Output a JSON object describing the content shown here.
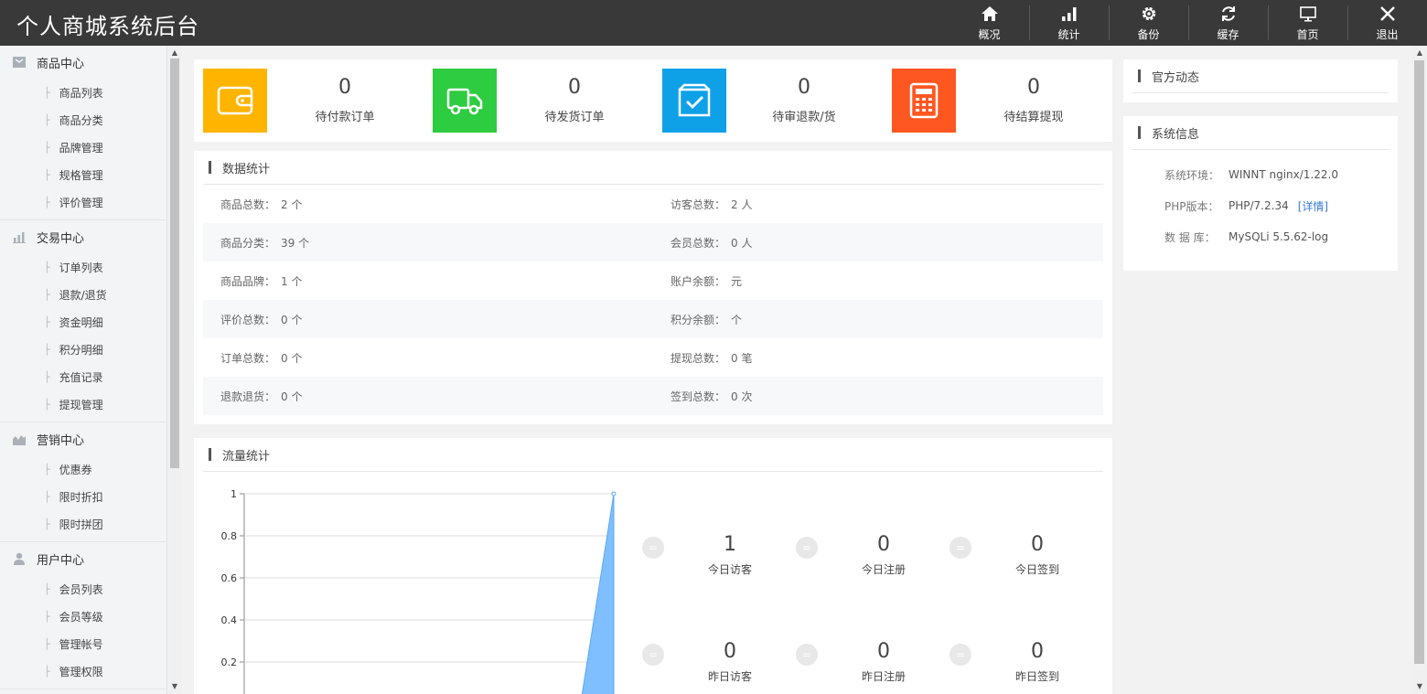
{
  "app": {
    "title": "个人商城系统后台"
  },
  "topnav": [
    {
      "label": "概况",
      "icon": "home-icon"
    },
    {
      "label": "统计",
      "icon": "bar-chart-icon"
    },
    {
      "label": "备份",
      "icon": "gear-icon"
    },
    {
      "label": "缓存",
      "icon": "refresh-icon"
    },
    {
      "label": "首页",
      "icon": "monitor-icon"
    },
    {
      "label": "退出",
      "icon": "close-icon"
    }
  ],
  "sidebar": {
    "groups": [
      {
        "title": "商品中心",
        "icon": "goods-icon",
        "items": [
          "商品列表",
          "商品分类",
          "品牌管理",
          "规格管理",
          "评价管理"
        ]
      },
      {
        "title": "交易中心",
        "icon": "bar-chart-icon",
        "items": [
          "订单列表",
          "退款/退货",
          "资金明细",
          "积分明细",
          "充值记录",
          "提现管理"
        ]
      },
      {
        "title": "营销中心",
        "icon": "area-chart-icon",
        "items": [
          "优惠券",
          "限时折扣",
          "限时拼团"
        ]
      },
      {
        "title": "用户中心",
        "icon": "user-icon",
        "items": [
          "会员列表",
          "会员等级",
          "管理帐号",
          "管理权限"
        ]
      }
    ]
  },
  "stats": [
    {
      "value": "0",
      "label": "待付款订单",
      "color": "#ffb400",
      "icon": "wallet-icon"
    },
    {
      "value": "0",
      "label": "待发货订单",
      "color": "#2ecc40",
      "icon": "truck-icon"
    },
    {
      "value": "0",
      "label": "待审退款/货",
      "color": "#0fa1e8",
      "icon": "check-box-icon"
    },
    {
      "value": "0",
      "label": "待结算提现",
      "color": "#ff5722",
      "icon": "calculator-icon"
    }
  ],
  "data_stats": {
    "title": "数据统计",
    "rows": [
      [
        {
          "key": "商品总数：",
          "val": "2 个"
        },
        {
          "key": "访客总数：",
          "val": "2 人"
        }
      ],
      [
        {
          "key": "商品分类：",
          "val": "39 个"
        },
        {
          "key": "会员总数：",
          "val": "0 人"
        }
      ],
      [
        {
          "key": "商品品牌：",
          "val": "1 个"
        },
        {
          "key": "账户余额：",
          "val": "元"
        }
      ],
      [
        {
          "key": "评价总数：",
          "val": "0 个"
        },
        {
          "key": "积分余额：",
          "val": "个"
        }
      ],
      [
        {
          "key": "订单总数：",
          "val": "0 个"
        },
        {
          "key": "提现总数：",
          "val": "0 笔"
        }
      ],
      [
        {
          "key": "退款退货：",
          "val": "0 个"
        },
        {
          "key": "签到总数：",
          "val": "0 次"
        }
      ]
    ]
  },
  "flow": {
    "title": "流量统计",
    "stats": [
      {
        "value": "1",
        "label": "今日访客"
      },
      {
        "value": "0",
        "label": "今日注册"
      },
      {
        "value": "0",
        "label": "今日签到"
      },
      {
        "value": "0",
        "label": "昨日访客"
      },
      {
        "value": "0",
        "label": "昨日注册"
      },
      {
        "value": "0",
        "label": "昨日签到"
      }
    ],
    "eq_symbol": "="
  },
  "chart_data": {
    "type": "area",
    "y_ticks": [
      "1",
      "0.8",
      "0.6",
      "0.4",
      "0.2"
    ],
    "ylim": [
      0,
      1
    ],
    "series": [
      {
        "values": [
          0,
          1
        ]
      }
    ],
    "fill_color": "#7fbfff"
  },
  "official_news": {
    "title": "官方动态"
  },
  "system_info": {
    "title": "系统信息",
    "rows": [
      {
        "key": "系统环境：",
        "val": "WINNT nginx/1.22.0"
      },
      {
        "key": "PHP版本：",
        "val": "PHP/7.2.34",
        "link": "[详情]"
      },
      {
        "key": "数 据 库：",
        "val": "MySQLi 5.5.62-log"
      }
    ]
  }
}
